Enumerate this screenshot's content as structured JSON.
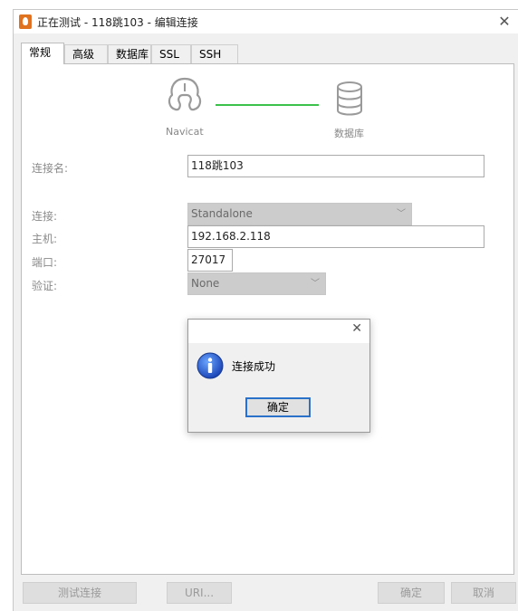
{
  "window": {
    "title": "正在测试 - 118跳103 - 编辑连接"
  },
  "tabs": [
    "常规",
    "高级",
    "数据库",
    "SSL",
    "SSH"
  ],
  "header": {
    "left_caption": "Navicat",
    "right_caption": "数据库"
  },
  "form": {
    "conn_name_label": "连接名:",
    "conn_name_value": "118跳103",
    "connection_label": "连接:",
    "connection_value": "Standalone",
    "host_label": "主机:",
    "host_value": "192.168.2.118",
    "port_label": "端口:",
    "port_value": "27017",
    "auth_label": "验证:",
    "auth_value": "None"
  },
  "dialog": {
    "message": "连接成功",
    "ok_label": "确定"
  },
  "footer": {
    "test_label": "测试连接",
    "uri_label": "URI...",
    "ok_label": "确定",
    "cancel_label": "取消"
  },
  "colors": {
    "accent_line": "#3cc04b",
    "focus_border": "#2a71c9",
    "app_icon": "#e0721f"
  },
  "icons": [
    "navicat-app-icon",
    "close-icon",
    "navicat-logo-icon",
    "database-icon",
    "info-icon",
    "chevron-down-icon"
  ]
}
